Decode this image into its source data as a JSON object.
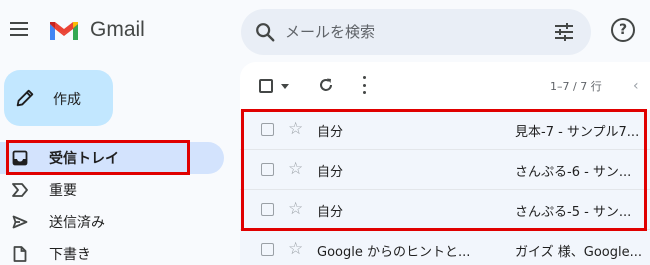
{
  "header": {
    "app_name": "Gmail",
    "search_placeholder": "メールを検索"
  },
  "sidebar": {
    "compose_label": "作成",
    "items": [
      {
        "label": "受信トレイ",
        "icon": "inbox-icon",
        "selected": true
      },
      {
        "label": "重要",
        "icon": "important-icon"
      },
      {
        "label": "送信済み",
        "icon": "sent-icon"
      },
      {
        "label": "下書き",
        "icon": "draft-icon"
      }
    ]
  },
  "toolbar": {
    "page_count": "1–7 / 7 行"
  },
  "emails": [
    {
      "sender": "自分",
      "subject": "見本-7 - サンプル7..."
    },
    {
      "sender": "自分",
      "subject": "さんぷる-6 - サン..."
    },
    {
      "sender": "自分",
      "subject": "さんぷる-5 - サン..."
    },
    {
      "sender": "Google からのヒントと...",
      "subject": "ガイズ 様、Google..."
    }
  ],
  "colors": {
    "highlight": "#e00000",
    "selected_nav": "#d3e3fd",
    "compose_bg": "#c2e7ff"
  }
}
